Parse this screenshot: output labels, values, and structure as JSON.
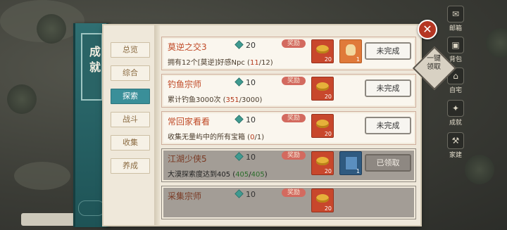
{
  "window": {
    "title": "成就",
    "close_icon": "✕"
  },
  "claim_all": {
    "label": "一键领取"
  },
  "categories": [
    {
      "label": "总览",
      "active": false
    },
    {
      "label": "综合",
      "active": false
    },
    {
      "label": "探索",
      "active": true
    },
    {
      "label": "战斗",
      "active": false
    },
    {
      "label": "收集",
      "active": false
    },
    {
      "label": "养成",
      "active": false
    }
  ],
  "reward_tag": "奖励",
  "achievements": [
    {
      "name": "莫逆之交3",
      "points": "20",
      "desc": "拥有12个[莫逆]好感Npc",
      "progress_cur": "11",
      "progress_max": "12",
      "rewards": [
        {
          "icon": "gold-ingot-icon",
          "qty": "20"
        },
        {
          "icon": "pouch-icon",
          "qty": "1"
        }
      ],
      "status": "未完成",
      "done": false
    },
    {
      "name": "钓鱼宗师",
      "points": "10",
      "desc": "累计钓鱼3000次",
      "progress_cur": "351",
      "progress_max": "3000",
      "rewards": [
        {
          "icon": "gold-ingot-icon",
          "qty": "20"
        }
      ],
      "status": "未完成",
      "done": false
    },
    {
      "name": "常回家看看",
      "points": "10",
      "desc": "收集无量屿中的所有宝箱",
      "progress_cur": "0",
      "progress_max": "1",
      "rewards": [
        {
          "icon": "gold-ingot-icon",
          "qty": "20"
        }
      ],
      "status": "未完成",
      "done": false
    },
    {
      "name": "江湖少侠5",
      "points": "10",
      "desc": "大漠探索度达到405",
      "progress_cur": "405",
      "progress_max": "405",
      "rewards": [
        {
          "icon": "gold-ingot-icon",
          "qty": "20"
        },
        {
          "icon": "book-icon",
          "qty": "1"
        }
      ],
      "status": "已领取",
      "done": true
    },
    {
      "name": "采集宗师",
      "points": "10",
      "desc": "",
      "progress_cur": "",
      "progress_max": "",
      "rewards": [
        {
          "icon": "gold-ingot-icon",
          "qty": "20"
        }
      ],
      "status": "",
      "done": true
    }
  ],
  "background": {
    "labels": [
      "邮箱",
      "背包",
      "自宅",
      "成就",
      "家建"
    ]
  }
}
